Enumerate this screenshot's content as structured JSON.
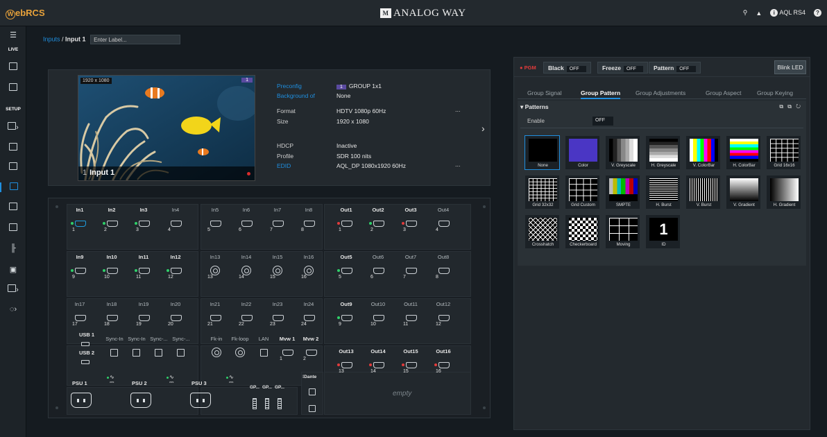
{
  "app": {
    "logo_mark": "W",
    "logo_text": "ebRCS",
    "brand_mark": "M",
    "brand": "ANALOG WAY",
    "device": "AQL RS4"
  },
  "sidebar": {
    "live_label": "LIVE",
    "setup_label": "SETUP"
  },
  "breadcrumb": {
    "parent": "Inputs",
    "separator": " / ",
    "current": "Input 1",
    "label_placeholder": "Enter Label..."
  },
  "input": {
    "resolution": "1920 x 1080",
    "badge": "1",
    "number": "1",
    "name": "Input 1",
    "details": [
      {
        "key": "Preconfig",
        "value": "GROUP 1x1",
        "pill": "1",
        "link": true
      },
      {
        "key": "Background of",
        "value": "None",
        "link": true
      },
      {
        "key": "Format",
        "value": "HDTV 1080p 60Hz",
        "link": false,
        "more": "..."
      },
      {
        "key": "Size",
        "value": "1920 x 1080",
        "link": false
      },
      {
        "key": "HDCP",
        "value": "Inactive",
        "link": false
      },
      {
        "key": "Profile",
        "value": "SDR 100 nits",
        "link": false
      },
      {
        "key": "EDID",
        "value": "AQL_DP 1080x1920 60Hz",
        "link": true,
        "more": "..."
      }
    ]
  },
  "rack": {
    "inputs": [
      {
        "label": "In1",
        "num": "1",
        "led": "g",
        "type": "hdmi",
        "bold": true,
        "active": true
      },
      {
        "label": "In2",
        "num": "2",
        "led": "g",
        "type": "hdmi",
        "bold": true
      },
      {
        "label": "In3",
        "num": "3",
        "led": "g",
        "type": "hdmi",
        "bold": true
      },
      {
        "label": "In4",
        "num": "4",
        "type": "hdmi"
      },
      {
        "label": "In5",
        "num": "5",
        "type": "hdmi"
      },
      {
        "label": "In6",
        "num": "6",
        "type": "hdmi"
      },
      {
        "label": "In7",
        "num": "7",
        "type": "hdmi"
      },
      {
        "label": "In8",
        "num": "8",
        "type": "hdmi"
      },
      {
        "label": "In9",
        "num": "9",
        "led": "g",
        "type": "hdmi",
        "bold": true
      },
      {
        "label": "In10",
        "num": "10",
        "led": "g",
        "type": "hdmi",
        "bold": true
      },
      {
        "label": "In11",
        "num": "11",
        "led": "g",
        "type": "hdmi",
        "bold": true
      },
      {
        "label": "In12",
        "num": "12",
        "led": "g",
        "type": "hdmi",
        "bold": true
      },
      {
        "label": "In13",
        "num": "13",
        "type": "coax"
      },
      {
        "label": "In14",
        "num": "14",
        "type": "coax"
      },
      {
        "label": "In15",
        "num": "15",
        "type": "coax"
      },
      {
        "label": "In16",
        "num": "16",
        "type": "coax"
      },
      {
        "label": "In17",
        "num": "17",
        "type": "hdmi"
      },
      {
        "label": "In18",
        "num": "18",
        "type": "hdmi"
      },
      {
        "label": "In19",
        "num": "19",
        "type": "hdmi"
      },
      {
        "label": "In20",
        "num": "20",
        "type": "hdmi"
      },
      {
        "label": "In21",
        "num": "21",
        "type": "hdmi"
      },
      {
        "label": "In22",
        "num": "22",
        "type": "hdmi"
      },
      {
        "label": "In23",
        "num": "23",
        "type": "hdmi"
      },
      {
        "label": "In24",
        "num": "24",
        "type": "hdmi"
      }
    ],
    "outputs": [
      {
        "label": "Out1",
        "num": "1",
        "led": "r",
        "type": "hdmi",
        "bold": true
      },
      {
        "label": "Out2",
        "num": "2",
        "led": "g",
        "type": "hdmi",
        "bold": true
      },
      {
        "label": "Out3",
        "num": "3",
        "led": "r",
        "type": "hdmi",
        "bold": true
      },
      {
        "label": "Out4",
        "num": "4",
        "type": "hdmi"
      },
      {
        "label": "Out5",
        "num": "5",
        "led": "g",
        "type": "hdmi",
        "bold": true
      },
      {
        "label": "Out6",
        "num": "6",
        "type": "hdmi"
      },
      {
        "label": "Out7",
        "num": "7",
        "type": "hdmi"
      },
      {
        "label": "Out8",
        "num": "8",
        "type": "hdmi"
      },
      {
        "label": "Out9",
        "num": "9",
        "led": "g",
        "type": "hdmi",
        "bold": true
      },
      {
        "label": "Out10",
        "num": "10",
        "type": "hdmi"
      },
      {
        "label": "Out11",
        "num": "11",
        "type": "hdmi"
      },
      {
        "label": "Out12",
        "num": "12",
        "type": "hdmi"
      },
      {
        "label": "Out13",
        "num": "13",
        "led": "r",
        "type": "hdmi",
        "bold": true
      },
      {
        "label": "Out14",
        "num": "14",
        "led": "r",
        "type": "hdmi",
        "bold": true
      },
      {
        "label": "Out15",
        "num": "15",
        "led": "r",
        "type": "hdmi",
        "bold": true
      },
      {
        "label": "Out16",
        "num": "16",
        "led": "r",
        "type": "hdmi",
        "bold": true
      }
    ],
    "usb": [
      "USB 1",
      "USB 2"
    ],
    "sync": [
      "Sync-In",
      "Sync-In",
      "Sync-...",
      "Sync-..."
    ],
    "misc": [
      {
        "label": "Fk-in",
        "num": "",
        "type": "coax"
      },
      {
        "label": "Fk-loop",
        "num": "",
        "type": "coax"
      },
      {
        "label": "LAN",
        "num": "",
        "type": "rj"
      },
      {
        "label": "Mvw 1",
        "num": "1",
        "type": "hdmi",
        "bold": true
      },
      {
        "label": "Mvw 2",
        "num": "2",
        "type": "hdmi",
        "bold": true
      }
    ],
    "psus": [
      "PSU 1",
      "PSU 2",
      "PSU 3"
    ],
    "ac_symbol": "∿",
    "dc_symbol": "⎓",
    "gpio": [
      "GP...",
      "GP...",
      "GP..."
    ],
    "dante": "⁞Dante",
    "empty": "empty"
  },
  "right": {
    "pgm": "● PGM",
    "controls": [
      {
        "label": "Black",
        "value": "OFF"
      },
      {
        "label": "Freeze",
        "value": "OFF"
      },
      {
        "label": "Pattern",
        "value": "OFF"
      }
    ],
    "blink": "Blink LED",
    "tabs": [
      "Group Signal",
      "Group Pattern",
      "Group Adjustments",
      "Group Aspect",
      "Group Keying"
    ],
    "active_tab": 1,
    "section_title": "▾ Patterns",
    "section_icons": "⧉ ⧉ ↻",
    "enable_label": "Enable",
    "enable_value": "OFF",
    "patterns": [
      "None",
      "Color",
      "V. Greyscale",
      "H. Greyscale",
      "V. ColorBar",
      "H. ColorBar",
      "Grid 16x16",
      "Grid 32x32",
      "Grid Custom",
      "SMPTE",
      "H. Burst",
      "V. Burst",
      "V. Gradient",
      "H. Gradient",
      "Crosshatch",
      "Checkerboard",
      "Moving",
      "ID"
    ],
    "selected_pattern": 0,
    "id_glyph": "1"
  }
}
